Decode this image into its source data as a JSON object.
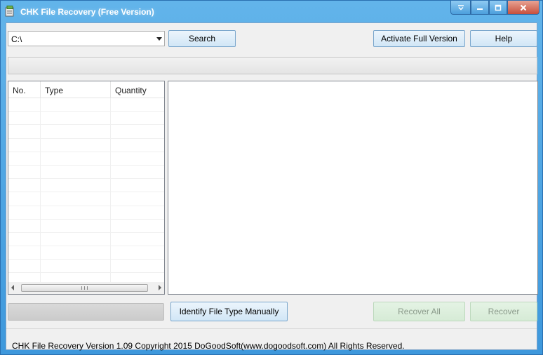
{
  "window": {
    "title": "CHK File Recovery (Free Version)"
  },
  "toolbar": {
    "drive_value": "C:\\",
    "search_label": "Search",
    "activate_label": "Activate Full Version",
    "help_label": "Help"
  },
  "list": {
    "columns": [
      "No.",
      "Type",
      "Quantity"
    ],
    "rows": []
  },
  "actions": {
    "identify_label": "Identify File Type Manually",
    "recover_all_label": "Recover All",
    "recover_label": "Recover"
  },
  "footer": {
    "text": "CHK File Recovery Version 1.09  Copyright 2015 DoGoodSoft(www.dogoodsoft.com) All Rights Reserved."
  },
  "colors": {
    "title_bar": "#4ea6e4",
    "button_face": "#dcedf9",
    "disabled_button_face": "#dcefdc",
    "close_button": "#c7503c"
  }
}
